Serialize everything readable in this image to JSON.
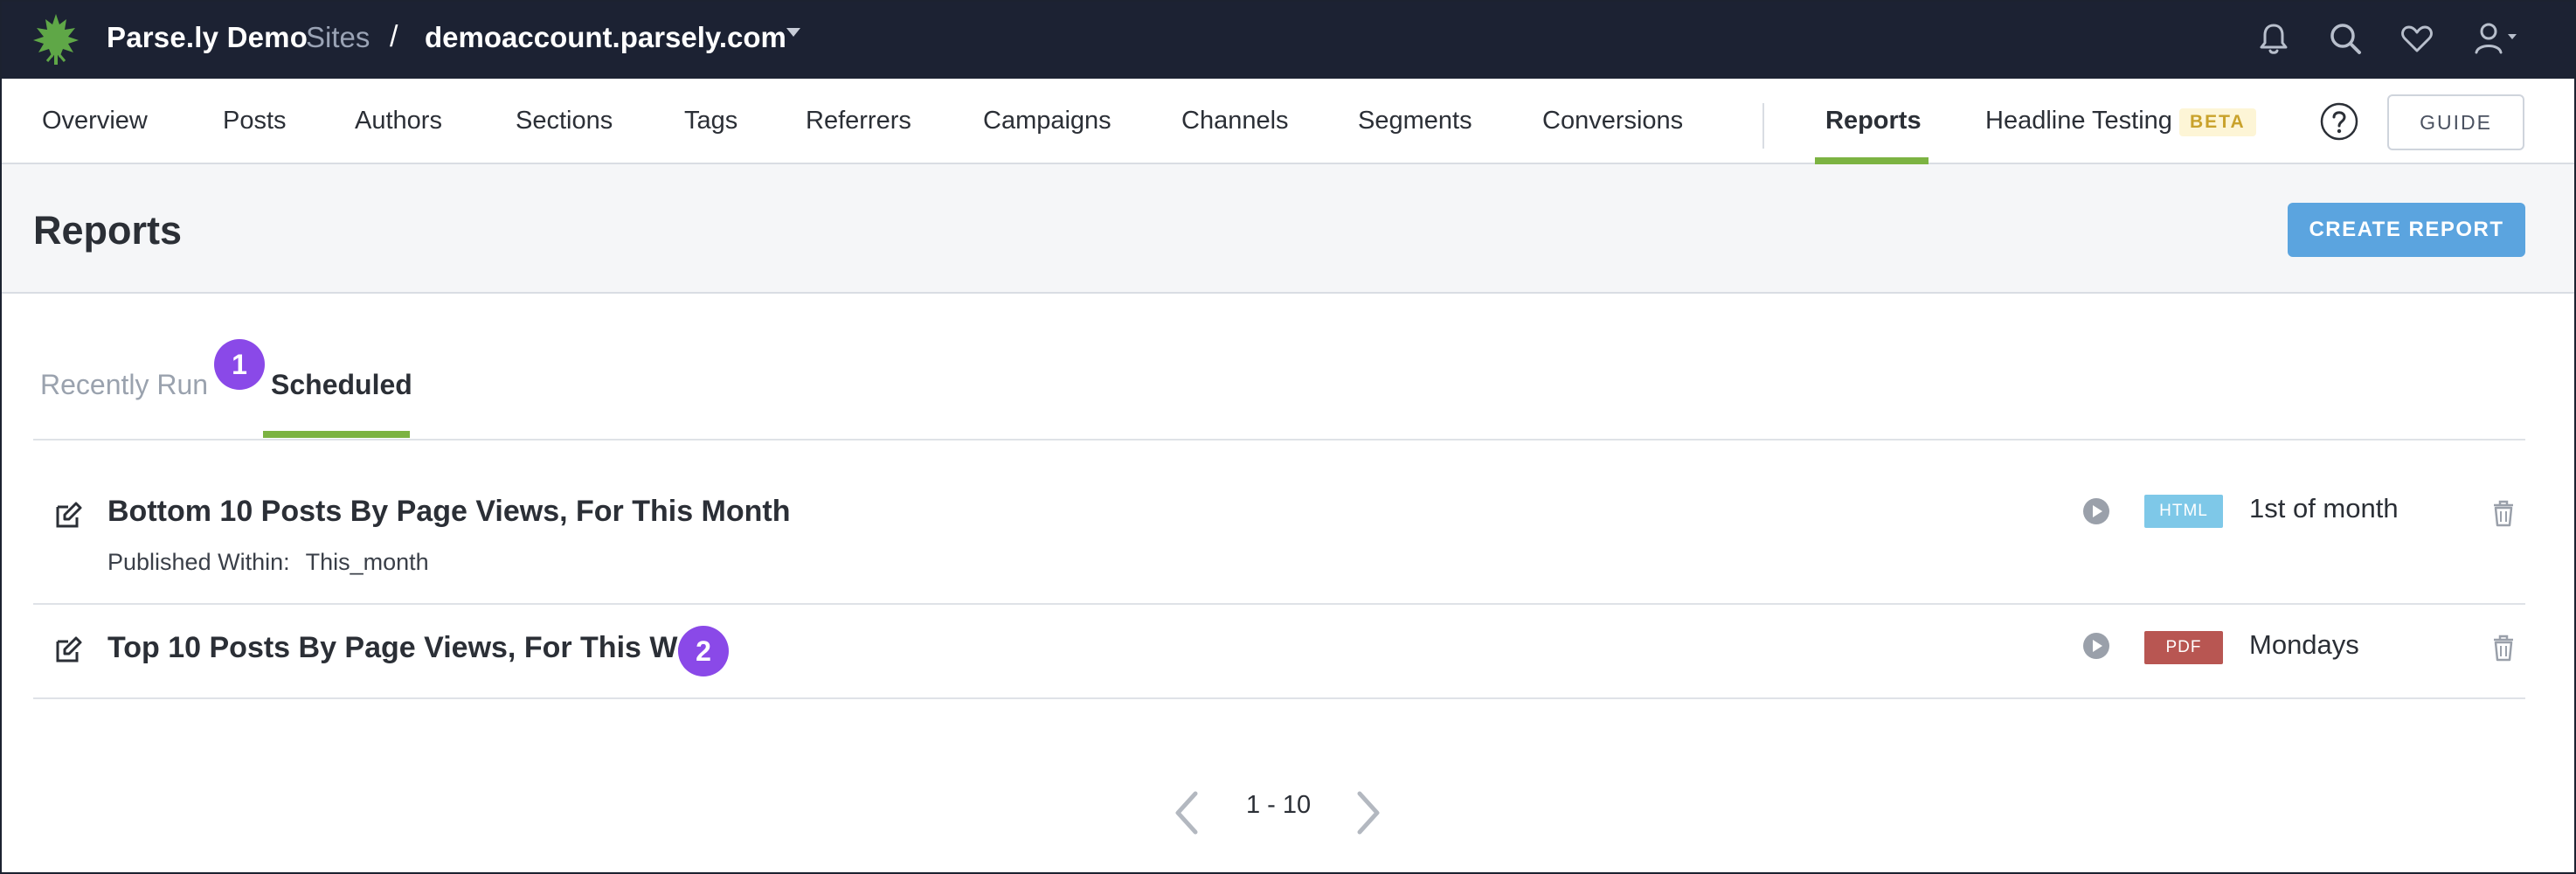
{
  "topbar": {
    "brand": "Parse.ly Demo",
    "sites_label": "Sites",
    "separator": "/",
    "site": "demoaccount.parsely.com",
    "icons": [
      "bell-icon",
      "search-icon",
      "heart-icon",
      "user-icon"
    ],
    "background_color": "#1c2233",
    "logo_color": "#5fa747"
  },
  "nav": {
    "items": [
      "Overview",
      "Posts",
      "Authors",
      "Sections",
      "Tags",
      "Referrers",
      "Campaigns",
      "Channels",
      "Segments",
      "Conversions"
    ],
    "reports": "Reports",
    "headline_testing": "Headline Testing",
    "beta": "BETA",
    "guide": "GUIDE",
    "active_accent": "#7cb342"
  },
  "page": {
    "title": "Reports",
    "create_button": "CREATE REPORT",
    "create_button_color": "#5ba4df"
  },
  "tabs": {
    "recently_run": "Recently Run",
    "scheduled": "Scheduled",
    "active": "Scheduled"
  },
  "markers": [
    "1",
    "2"
  ],
  "reports": [
    {
      "title": "Bottom 10 Posts By Page Views, For This Month",
      "sub_label": "Published Within:",
      "sub_value": "This_month",
      "format": "HTML",
      "format_color": "#7ec8e8",
      "schedule": "1st of month"
    },
    {
      "title": "Top 10 Posts By Page Views, For This Week",
      "format": "PDF",
      "format_color": "#b85652",
      "schedule": "Mondays"
    }
  ],
  "pagination": {
    "range": "1 - 10"
  }
}
